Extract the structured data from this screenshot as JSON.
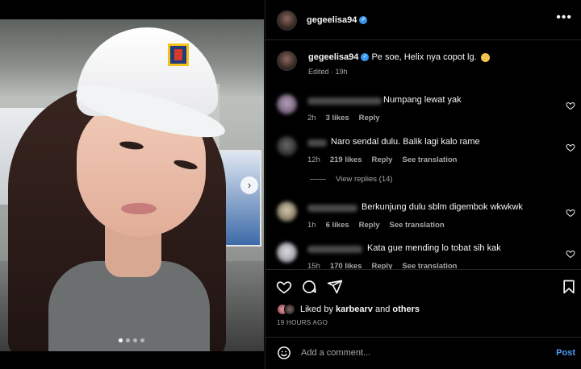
{
  "post": {
    "author": "gegeelisa94",
    "caption_author": "gegeelisa94",
    "caption_text": "Pe soe, Helix nya copot lg.",
    "caption_meta": "Edited · 19h",
    "media": {
      "slides": 4,
      "active_slide": 1
    }
  },
  "comments": [
    {
      "text": "Numpang lewat yak",
      "time": "2h",
      "likes": "3 likes",
      "reply": "Reply",
      "translation": ""
    },
    {
      "text": "Naro sendal dulu. Balik lagi kalo rame",
      "time": "12h",
      "likes": "219 likes",
      "reply": "Reply",
      "translation": "See translation"
    },
    {
      "text": "Berkunjung dulu sblm digembok wkwkwk",
      "time": "1h",
      "likes": "6 likes",
      "reply": "Reply",
      "translation": "See translation"
    },
    {
      "text": "Kata gue mending lo tobat sih kak",
      "time": "15h",
      "likes": "170 likes",
      "reply": "Reply",
      "translation": "See translation"
    }
  ],
  "view_replies": "View replies (14)",
  "likes_line": {
    "prefix": "Liked by ",
    "user": "karbearv",
    "middle": " and ",
    "others": "others"
  },
  "time_ago": "19 HOURS AGO",
  "add_comment": {
    "placeholder": "Add a comment...",
    "post_label": "Post"
  },
  "icons": {
    "more": "more-options-icon",
    "verified": "verified-badge-icon",
    "like": "heart-icon",
    "comment": "comment-icon",
    "share": "share-icon",
    "save": "bookmark-icon",
    "emoji": "emoji-icon",
    "next": "chevron-right-icon"
  },
  "colors": {
    "background": "#000000",
    "link": "#4f9cf5",
    "verified": "#3897f0",
    "muted": "#a8a8a8"
  }
}
